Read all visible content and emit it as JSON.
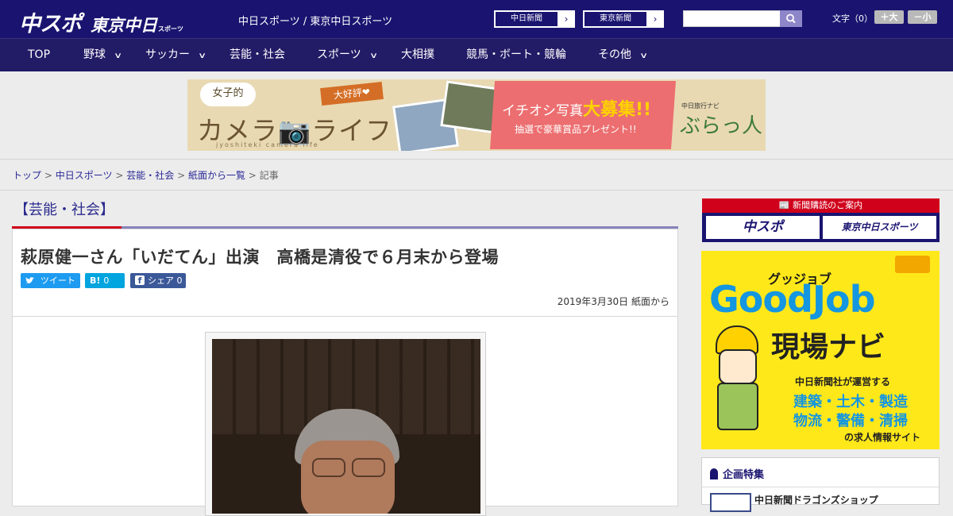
{
  "header": {
    "logo_main": "中スポ",
    "logo_tokyo": "東京中日",
    "logo_small": "スポーツ",
    "site_title": "中日スポーツ / 東京中日スポーツ",
    "paper_links": [
      {
        "label": "中日新聞",
        "arrow": "›"
      },
      {
        "label": "東京新聞",
        "arrow": "›"
      }
    ],
    "search": {
      "value": "",
      "icon": "search-icon"
    },
    "text_size_label": "文字（0）",
    "text_larger": "＋大",
    "text_smaller": "－小"
  },
  "nav": {
    "items": [
      {
        "label": "TOP",
        "dropdown": false
      },
      {
        "label": "野球",
        "dropdown": true
      },
      {
        "label": "サッカー",
        "dropdown": true
      },
      {
        "label": "芸能・社会",
        "dropdown": false
      },
      {
        "label": "スポーツ",
        "dropdown": true
      },
      {
        "label": "大相撲",
        "dropdown": false
      },
      {
        "label": "競馬・ボート・競輪",
        "dropdown": false
      },
      {
        "label": "その他",
        "dropdown": true
      }
    ],
    "chevron": "∨"
  },
  "banner": {
    "bubble": "女子的",
    "title": "カメラ📷ライフ",
    "subtitle": "jyoshiteki camera life",
    "ribbon": "大好評❤",
    "promo_line1_a": "イチオシ写真",
    "promo_line1_b": "大募集!!",
    "promo_line2": "抽選で豪華賞品プレゼント!!",
    "sponsor_small": "中日旅行ナビ",
    "sponsor": "ぶらっ人"
  },
  "breadcrumb": {
    "items": [
      "トップ",
      "中日スポーツ",
      "芸能・社会",
      "紙面から一覧"
    ],
    "current": "記事",
    "separator": ">"
  },
  "article": {
    "category": "【芸能・社会】",
    "headline": "萩原健一さん「いだてん」出演　高橋是清役で６月末から登場",
    "share": [
      {
        "icon": "twitter-icon",
        "glyph": "🐦",
        "label": "ツイート",
        "count": "",
        "color": "#1d9bf0"
      },
      {
        "icon": "hatena-icon",
        "glyph": "B!",
        "label": "",
        "count": "0",
        "color": "#00a4de"
      },
      {
        "icon": "facebook-icon",
        "glyph": "f",
        "label": "シェア",
        "count": "0",
        "color": "#3b5998"
      }
    ],
    "dateline": "2019年3月30日 紙面から"
  },
  "sidebar": {
    "subscribe_heading": "📰 新聞購読のご案内",
    "subscribe_buttons": [
      "中スポ",
      "東京中日スポーツ"
    ],
    "goodjob": {
      "kana": "グッジョブ",
      "title": "GoodJob",
      "subtitle": "現場ナビ",
      "line1": "中日新聞社が運営する",
      "line2": "建築・土木・製造",
      "line3": "物流・警備・清掃",
      "line4": "の求人情報サイト"
    },
    "feature_heading": "企画特集",
    "feature_item": "中日新聞ドラゴンズショップ"
  },
  "colors": {
    "header_bg": "#1a1470",
    "nav_bg": "#221b66",
    "accent_red": "#d0021b",
    "link": "#2a2896"
  }
}
